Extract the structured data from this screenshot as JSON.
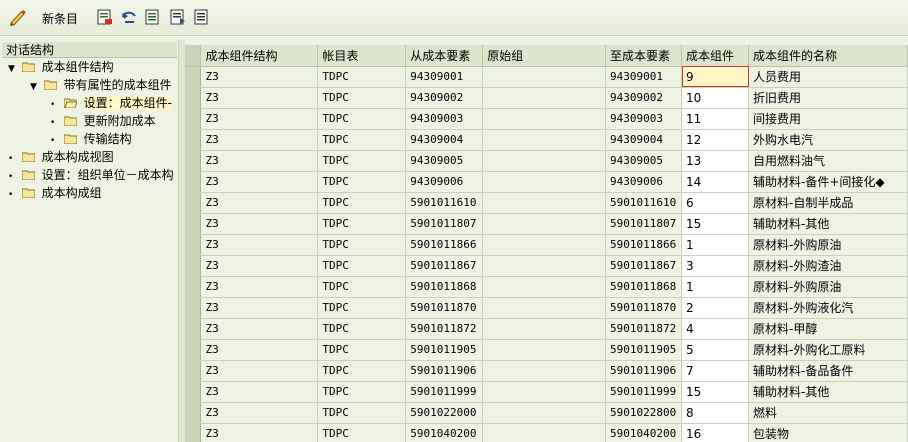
{
  "toolbar": {
    "new_entries_label": "新条目",
    "icons": [
      "edit-pen-icon",
      "save-icon",
      "undo-icon",
      "copy-icon",
      "select-block-icon",
      "deselect-icon"
    ]
  },
  "left_pane": {
    "title": "对话结构",
    "tree": [
      {
        "label": "成本组件结构",
        "expanded": true
      },
      {
        "label": "带有属性的成本组件",
        "expanded": true
      },
      {
        "label": "设置：成本组件-",
        "selected": true
      },
      {
        "label": "更新附加成本"
      },
      {
        "label": "传输结构"
      },
      {
        "label": "成本构成视图"
      },
      {
        "label": "设置：组织单位－成本构"
      },
      {
        "label": "成本构成组"
      }
    ]
  },
  "table": {
    "columns": [
      "成本组件结构",
      "帐目表",
      "从成本要素",
      "原始组",
      "至成本要素",
      "成本组件",
      "成本组件的名称"
    ],
    "rows": [
      [
        "Z3",
        "TDPC",
        "94309001",
        "",
        "94309001",
        "9",
        "人员费用"
      ],
      [
        "Z3",
        "TDPC",
        "94309002",
        "",
        "94309002",
        "10",
        "折旧费用"
      ],
      [
        "Z3",
        "TDPC",
        "94309003",
        "",
        "94309003",
        "11",
        "间接费用"
      ],
      [
        "Z3",
        "TDPC",
        "94309004",
        "",
        "94309004",
        "12",
        "外购水电汽"
      ],
      [
        "Z3",
        "TDPC",
        "94309005",
        "",
        "94309005",
        "13",
        "自用燃料油气"
      ],
      [
        "Z3",
        "TDPC",
        "94309006",
        "",
        "94309006",
        "14",
        "辅助材料-备件+间接化◆"
      ],
      [
        "Z3",
        "TDPC",
        "5901011610",
        "",
        "5901011610",
        "6",
        "原材料-自制半成品"
      ],
      [
        "Z3",
        "TDPC",
        "5901011807",
        "",
        "5901011807",
        "15",
        "辅助材料-其他"
      ],
      [
        "Z3",
        "TDPC",
        "5901011866",
        "",
        "5901011866",
        "1",
        "原材料-外购原油"
      ],
      [
        "Z3",
        "TDPC",
        "5901011867",
        "",
        "5901011867",
        "3",
        "原材料-外购渣油"
      ],
      [
        "Z3",
        "TDPC",
        "5901011868",
        "",
        "5901011868",
        "1",
        "原材料-外购原油"
      ],
      [
        "Z3",
        "TDPC",
        "5901011870",
        "",
        "5901011870",
        "2",
        "原材料-外购液化汽"
      ],
      [
        "Z3",
        "TDPC",
        "5901011872",
        "",
        "5901011872",
        "4",
        "原材料-甲醇"
      ],
      [
        "Z3",
        "TDPC",
        "5901011905",
        "",
        "5901011905",
        "5",
        "原材料-外购化工原料"
      ],
      [
        "Z3",
        "TDPC",
        "5901011906",
        "",
        "5901011906",
        "7",
        "辅助材料-备品备件"
      ],
      [
        "Z3",
        "TDPC",
        "5901011999",
        "",
        "5901011999",
        "15",
        "辅助材料-其他"
      ],
      [
        "Z3",
        "TDPC",
        "5901022000",
        "",
        "5901022800",
        "8",
        "燃料"
      ],
      [
        "Z3",
        "TDPC",
        "5901040200",
        "",
        "5901040200",
        "16",
        "包装物"
      ]
    ]
  },
  "colors": {
    "background": "#eef3e4",
    "header": "#dde6cc",
    "focus_cell": "#fff7c8",
    "focus_border": "#cc3333"
  }
}
